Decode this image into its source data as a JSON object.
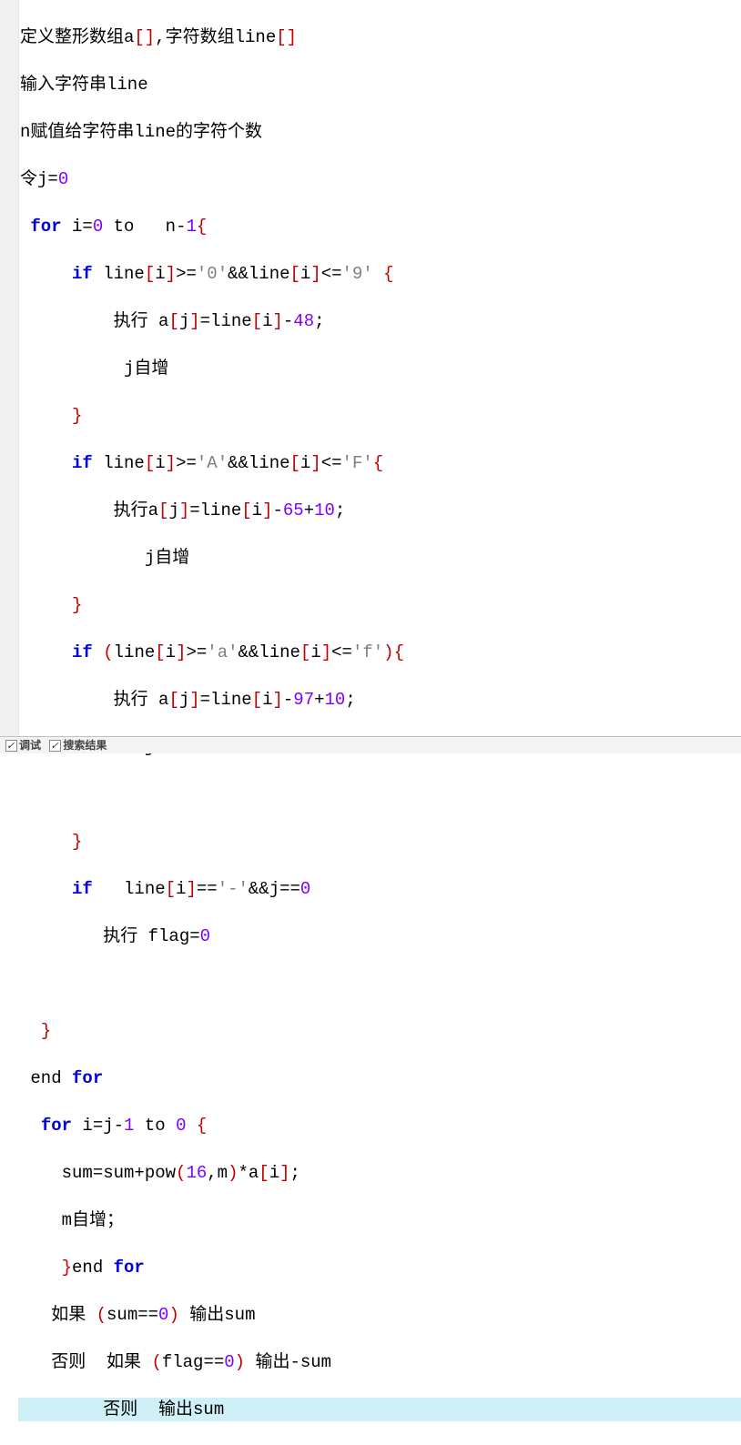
{
  "code": {
    "l1": {
      "a": "定义整形数组a",
      "b": ",字符数组line"
    },
    "l2": {
      "a": "输入字符串line"
    },
    "l3": {
      "a": "n赋值给字符串line的字符个数"
    },
    "l4": {
      "a": "令j=",
      "n0": "0"
    },
    "l5": {
      "sp": " ",
      "kw": "for",
      "a": " i=",
      "n0": "0",
      "b": " to   n-",
      "n1": "1",
      "br": "{"
    },
    "l6": {
      "sp": "     ",
      "kw": "if",
      "a": " line",
      "br1": "[",
      "b": "i",
      "br2": "]",
      "c": ">=",
      "q1": "'",
      "s1": "0",
      "q2": "'",
      "d": "&&line",
      "br3": "[",
      "e": "i",
      "br4": "]",
      "f": "<=",
      "q3": "'",
      "s2": "9",
      "q4": "'",
      "sp2": " ",
      "br5": "{"
    },
    "l7": {
      "sp": "         ",
      "a": "执行 a",
      "br1": "[",
      "b": "j",
      "br2": "]",
      "c": "=line",
      "br3": "[",
      "d": "i",
      "br4": "]",
      "e": "-",
      "n": "48",
      "f": ";"
    },
    "l8": {
      "sp": "          ",
      "a": "j自增"
    },
    "l9": {
      "sp": "     ",
      "br": "}"
    },
    "l10": {
      "sp": "     ",
      "kw": "if",
      "a": " line",
      "br1": "[",
      "b": "i",
      "br2": "]",
      "c": ">=",
      "q1": "'",
      "s1": "A",
      "q2": "'",
      "d": "&&line",
      "br3": "[",
      "e": "i",
      "br4": "]",
      "f": "<=",
      "q3": "'",
      "s2": "F",
      "q4": "'",
      "br5": "{"
    },
    "l11": {
      "sp": "         ",
      "a": "执行a",
      "br1": "[",
      "b": "j",
      "br2": "]",
      "c": "=line",
      "br3": "[",
      "d": "i",
      "br4": "]",
      "e": "-",
      "n1": "65",
      "f": "+",
      "n2": "10",
      "g": ";"
    },
    "l12": {
      "sp": "            ",
      "a": "j自增"
    },
    "l13": {
      "sp": "     ",
      "br": "}"
    },
    "l14": {
      "sp": "     ",
      "kw": "if",
      "sp2": " ",
      "br0": "(",
      "a": "line",
      "br1": "[",
      "b": "i",
      "br2": "]",
      "c": ">=",
      "q1": "'",
      "s1": "a",
      "q2": "'",
      "d": "&&line",
      "br3": "[",
      "e": "i",
      "br4": "]",
      "f": "<=",
      "q3": "'",
      "s2": "f",
      "q4": "'",
      "br5": "){"
    },
    "l15": {
      "sp": "         ",
      "a": "执行 a",
      "br1": "[",
      "b": "j",
      "br2": "]",
      "c": "=line",
      "br3": "[",
      "d": "i",
      "br4": "]",
      "e": "-",
      "n1": "97",
      "f": "+",
      "n2": "10",
      "g": ";"
    },
    "l16": {
      "sp": "            ",
      "a": "j自增"
    },
    "l17": {
      "sp": ""
    },
    "l18": {
      "sp": "     ",
      "br": "}"
    },
    "l19": {
      "sp": "     ",
      "kw": "if",
      "a": "   line",
      "br1": "[",
      "b": "i",
      "br2": "]",
      "c": "==",
      "q1": "'",
      "s1": "-",
      "q2": "'",
      "d": "&&j==",
      "n": "0"
    },
    "l20": {
      "sp": "        ",
      "a": "执行 flag=",
      "n": "0"
    },
    "l21": {
      "sp": ""
    },
    "l22": {
      "sp": "  ",
      "br": "}"
    },
    "l23": {
      "sp": " ",
      "a": "end ",
      "kw": "for"
    },
    "l24": {
      "sp": "  ",
      "kw": "for",
      "a": " i=j-",
      "n1": "1",
      "b": " to ",
      "n2": "0",
      "sp2": " ",
      "br": "{"
    },
    "l25": {
      "sp": "    ",
      "a": "sum=sum+pow",
      "br1": "(",
      "n": "16",
      "b": ",m",
      "br2": ")",
      "c": "*a",
      "br3": "[",
      "d": "i",
      "br4": "]",
      "e": ";"
    },
    "l26": {
      "sp": "    ",
      "a": "m自增；"
    },
    "l27": {
      "sp": "    ",
      "br": "}",
      "a": "end ",
      "kw": "for"
    },
    "l28": {
      "sp": "   ",
      "a": "如果 ",
      "br1": "(",
      "b": "sum==",
      "n": "0",
      "br2": ")",
      "c": " 输出sum"
    },
    "l29": {
      "sp": "   ",
      "a": "否则  如果 ",
      "br1": "(",
      "b": "flag==",
      "n": "0",
      "br2": ")",
      "c": " 输出-sum"
    },
    "l30": {
      "sp": "        ",
      "a": "否则  输出sum"
    }
  },
  "footer": {
    "tab1": "调试",
    "tab2": "搜索结果"
  }
}
